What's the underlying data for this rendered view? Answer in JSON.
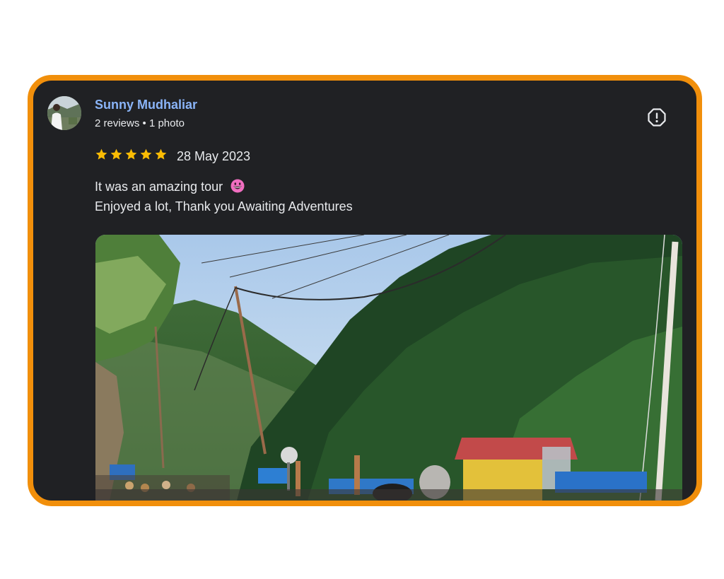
{
  "review": {
    "reviewer_name": "Sunny Mudhaliar",
    "reviewer_meta": "2 reviews • 1 photo",
    "rating": 5,
    "rating_max": 5,
    "date": "28 May 2023",
    "text_line1": "It was an amazing tour",
    "text_line2": "Enjoyed a lot, Thank you Awaiting Adventures",
    "photo_count": 1
  },
  "icons": {
    "report": "report-flag-icon",
    "star": "star-icon",
    "emoji": "grinning-face-emoji"
  },
  "colors": {
    "card_background": "#202124",
    "card_border": "#f18f0b",
    "name_link": "#8ab4f8",
    "star": "#fbbc04",
    "text": "#e8eaed"
  }
}
